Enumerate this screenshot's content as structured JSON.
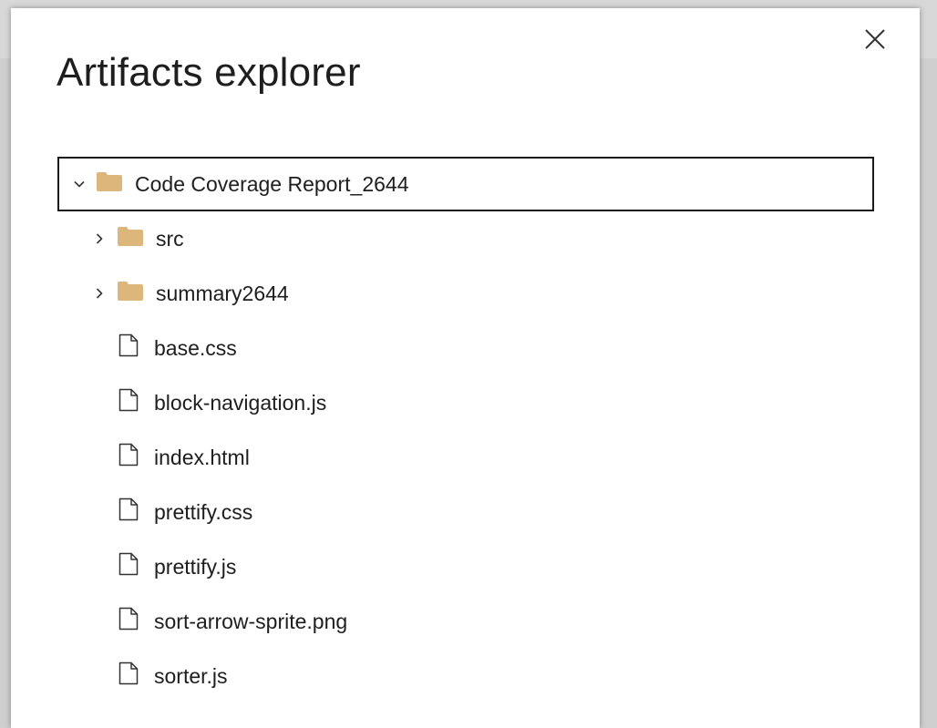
{
  "dialog": {
    "title": "Artifacts explorer",
    "close_icon": "close-icon"
  },
  "tree": {
    "root": {
      "label": "Code Coverage Report_2644",
      "expanded": true,
      "icon": "folder-icon"
    },
    "folders": [
      {
        "label": "src",
        "expanded": false,
        "icon": "folder-icon"
      },
      {
        "label": "summary2644",
        "expanded": false,
        "icon": "folder-icon"
      }
    ],
    "files": [
      {
        "label": "base.css",
        "icon": "file-icon"
      },
      {
        "label": "block-navigation.js",
        "icon": "file-icon"
      },
      {
        "label": "index.html",
        "icon": "file-icon"
      },
      {
        "label": "prettify.css",
        "icon": "file-icon"
      },
      {
        "label": "prettify.js",
        "icon": "file-icon"
      },
      {
        "label": "sort-arrow-sprite.png",
        "icon": "file-icon"
      },
      {
        "label": "sorter.js",
        "icon": "file-icon"
      }
    ]
  },
  "colors": {
    "folder": "#dcb67a",
    "text": "#1e1e1e",
    "focus_border": "#1a1a1a",
    "background": "#ffffff"
  }
}
